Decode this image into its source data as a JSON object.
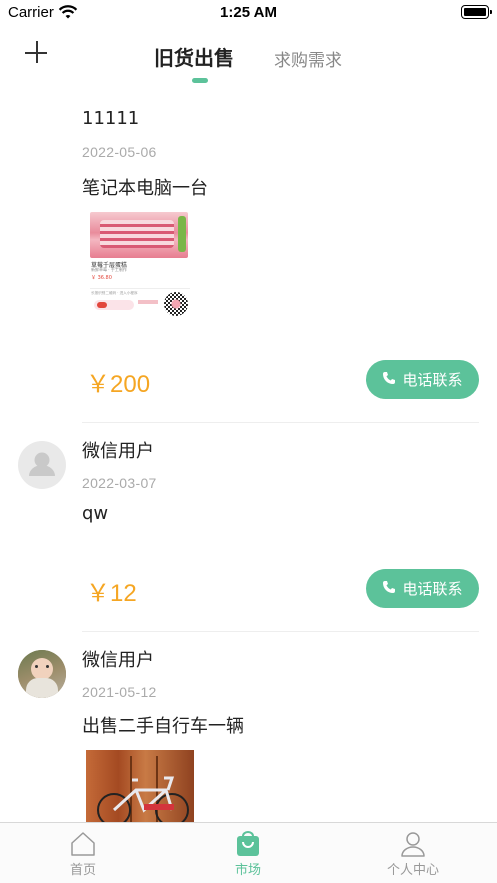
{
  "status_bar": {
    "carrier": "Carrier",
    "time": "1:25 AM"
  },
  "nav": {
    "tab_active": "旧货出售",
    "tab_inactive": "求购需求"
  },
  "posts": [
    {
      "username": "11111",
      "date": "2022-05-06",
      "description": "笔记本电脑一台",
      "price": "￥200",
      "call_label": "电话联系",
      "thumb": {
        "product_name": "草莓千层蛋糕",
        "product_sub": "新鲜草莓 · 手工制作",
        "product_price": "￥ 36.80",
        "store_text": "长按识别二维码 · 进入小程序"
      }
    },
    {
      "username": "微信用户",
      "date": "2022-03-07",
      "description": "qw",
      "price": "￥12",
      "call_label": "电话联系"
    },
    {
      "username": "微信用户",
      "date": "2021-05-12",
      "description": "出售二手自行车一辆"
    }
  ],
  "tab_bar": [
    {
      "label": "首页"
    },
    {
      "label": "市场"
    },
    {
      "label": "个人中心"
    }
  ],
  "colors": {
    "accent": "#5cc29a",
    "price": "#f5a623"
  }
}
